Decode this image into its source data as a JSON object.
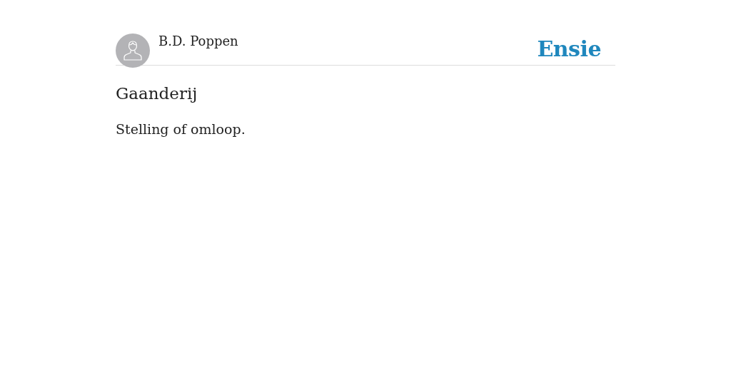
{
  "author": {
    "name": "B.D. Poppen"
  },
  "logo": "Ensie",
  "entry": {
    "title": "Gaanderij",
    "definition": "Stelling of omloop."
  }
}
